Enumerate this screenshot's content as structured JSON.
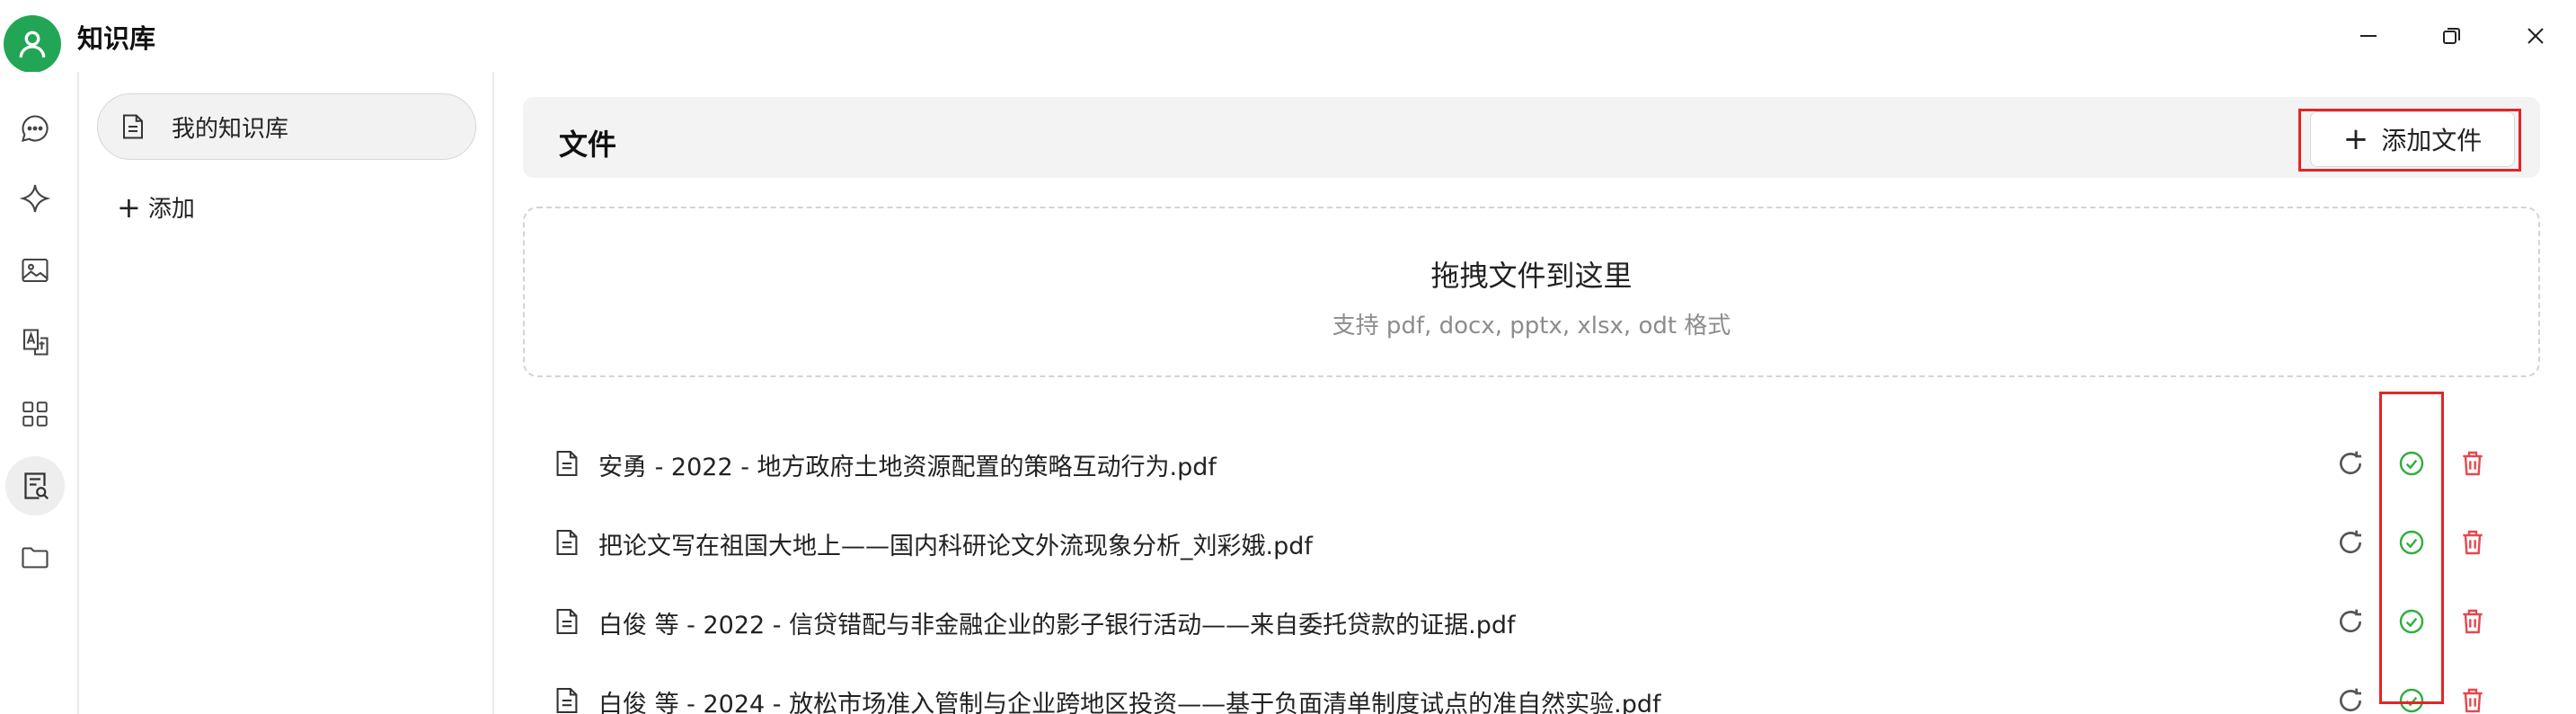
{
  "app": {
    "title": "知识库"
  },
  "window_controls": [
    "minimize",
    "restore",
    "close"
  ],
  "iconbar": {
    "items": [
      {
        "name": "chat-icon",
        "active": false
      },
      {
        "name": "sparkle-icon",
        "active": false
      },
      {
        "name": "image-icon",
        "active": false
      },
      {
        "name": "translate-icon",
        "active": false
      },
      {
        "name": "apps-grid-icon",
        "active": false
      },
      {
        "name": "knowledge-base-icon",
        "active": true
      },
      {
        "name": "folder-icon",
        "active": false
      }
    ]
  },
  "kb_sidebar": {
    "items": [
      {
        "label": "我的知识库",
        "icon": "document-icon"
      }
    ],
    "add_label": "添加"
  },
  "files": {
    "title": "文件",
    "add_button_label": "添加文件",
    "dropzone": {
      "title": "拖拽文件到这里",
      "subtitle": "支持 pdf, docx, pptx, xlsx, odt 格式"
    },
    "rows": [
      {
        "name": "安勇 - 2022 - 地方政府土地资源配置的策略互动行为.pdf",
        "status": "success"
      },
      {
        "name": "把论文写在祖国大地上——国内科研论文外流现象分析_刘彩娥.pdf",
        "status": "success"
      },
      {
        "name": "白俊 等 - 2022 - 信贷错配与非金融企业的影子银行活动——来自委托贷款的证据.pdf",
        "status": "success"
      },
      {
        "name": "白俊 等 - 2024 - 放松市场准入管制与企业跨地区投资——基于负面清单制度试点的准自然实验.pdf",
        "status": "success"
      }
    ]
  },
  "colors": {
    "avatar": "#22a655",
    "success": "#2eae3b",
    "delete": "#e5484d",
    "highlight": "#e52424"
  }
}
